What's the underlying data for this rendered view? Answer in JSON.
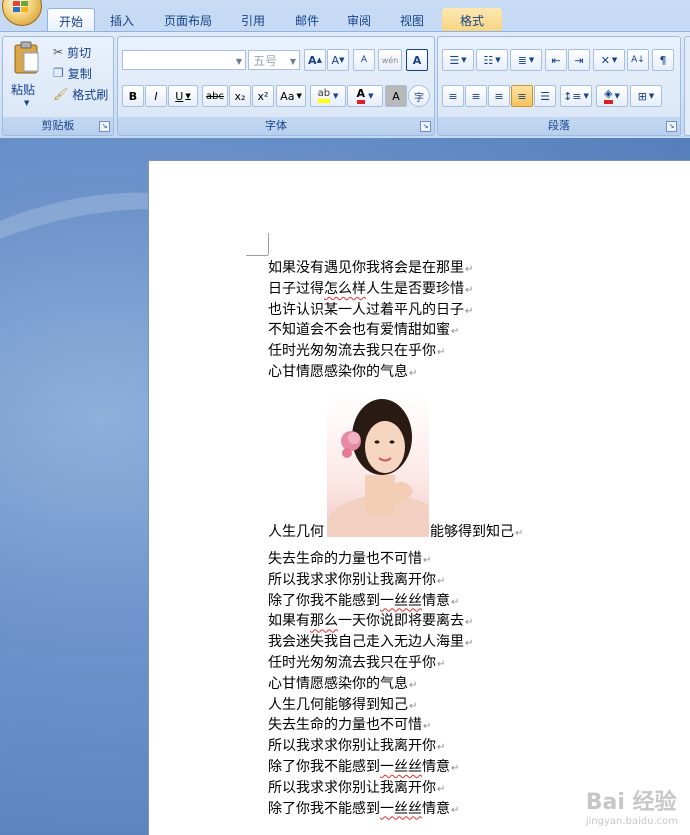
{
  "tabs": [
    {
      "label": "开始",
      "active": true
    },
    {
      "label": "插入"
    },
    {
      "label": "页面布局"
    },
    {
      "label": "引用"
    },
    {
      "label": "邮件"
    },
    {
      "label": "审阅"
    },
    {
      "label": "视图"
    },
    {
      "label": "格式",
      "contextual": true
    }
  ],
  "clipboard": {
    "paste_label": "粘贴",
    "cut_label": "剪切",
    "copy_label": "复制",
    "format_painter_label": "格式刷",
    "group_label": "剪贴板"
  },
  "font": {
    "font_name": "",
    "font_size": "五号",
    "bold": "B",
    "italic": "I",
    "underline": "U",
    "strikethrough": "abc",
    "subscript": "x₂",
    "superscript": "x²",
    "change_case": "Aa",
    "grow_font": "A",
    "shrink_font": "A",
    "clear_format": "A",
    "phonetic": "wén",
    "char_border": "A",
    "char_shading": "A",
    "enclose": "字",
    "group_label": "字体"
  },
  "paragraph": {
    "group_label": "段落"
  },
  "colors": {
    "accent": "#15428b",
    "highlight": "#ffff00",
    "font_color": "#e02020",
    "shading_fill": "#e02020"
  },
  "document": {
    "lines_top": [
      "如果没有遇见你我将会是在那里",
      "日子过得怎么样人生是否要珍惜",
      "也许认识某一人过着平凡的日子",
      "不知道会不会也有爱情甜如蜜",
      "任时光匆匆流去我只在乎你",
      "心甘情愿感染你的气息"
    ],
    "image_line_before": "人生几何",
    "image_line_after": "能够得到知己",
    "lines_bottom": [
      "失去生命的力量也不可惜",
      "所以我求求你别让我离开你",
      "除了你我不能感到一丝丝情意",
      "如果有那么一天你说即将要离去",
      "我会迷失我自己走入无边人海里",
      "任时光匆匆流去我只在乎你",
      "心甘情愿感染你的气息",
      "人生几何能够得到知己",
      "失去生命的力量也不可惜",
      "所以我求求你别让我离开你",
      "除了你我不能感到一丝丝情意",
      "所以我求求你别让我离开你",
      "除了你我不能感到一丝丝情意"
    ],
    "paragraph_mark": "↵"
  },
  "watermark": {
    "text": "Bai 经验",
    "sub": "jingyan.baidu.com"
  }
}
